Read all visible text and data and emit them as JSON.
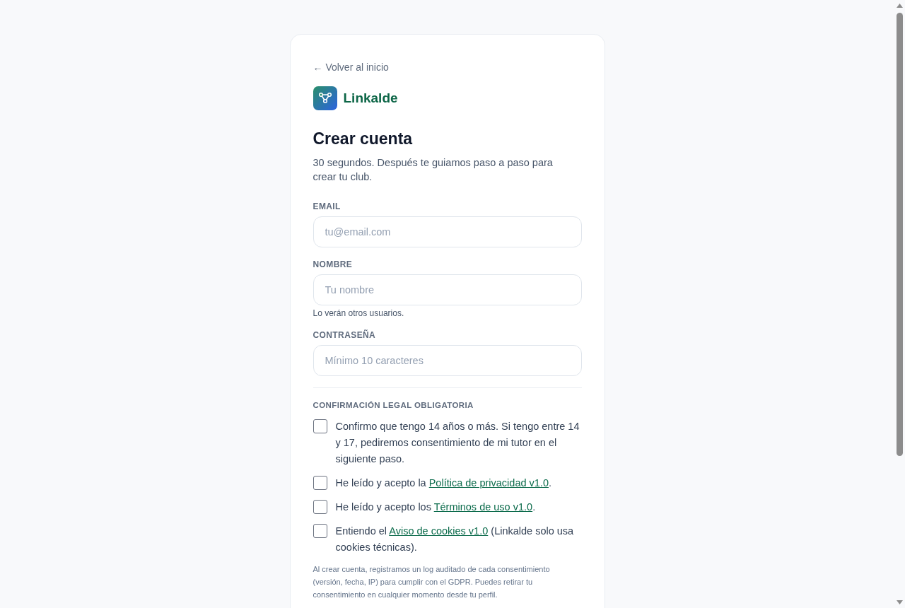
{
  "back_link": "← Volver al inicio",
  "brand": {
    "name": "Linkalde"
  },
  "title": "Crear cuenta",
  "subtitle": "30 segundos. Después te guiamos paso a paso para crear tu club.",
  "fields": [
    {
      "label": "EMAIL",
      "placeholder": "tu@email.com"
    },
    {
      "label": "NOMBRE",
      "placeholder": "Tu nombre",
      "hint": "Lo verán otros usuarios."
    },
    {
      "label": "CONTRASEÑA",
      "placeholder": "Mínimo 10 caracteres"
    }
  ],
  "legal": {
    "heading": "CONFIRMACIÓN LEGAL OBLIGATORIA",
    "items": [
      {
        "checked": false,
        "text": "Confirmo que tengo 14 años o más. Si tengo entre 14 y 17, pediremos consentimiento de mi tutor en el siguiente paso."
      },
      {
        "checked": false,
        "text": "He leído y acepto la ",
        "link": "Política de privacidad v1.0",
        "text_after": "."
      },
      {
        "checked": false,
        "text": "He leído y acepto los ",
        "link": "Términos de uso v1.0",
        "text_after": "."
      },
      {
        "checked": false,
        "text": "Entiendo el ",
        "link": "Aviso de cookies v1.0",
        "text_after": " (Linkalde solo usa cookies técnicas)."
      }
    ],
    "note": "Al crear cuenta, registramos un log auditado de cada consentimiento (versión, fecha, IP) para cumplir con el GDPR. Puedes retirar tu consentimiento en cualquier momento desde tu perfil."
  }
}
